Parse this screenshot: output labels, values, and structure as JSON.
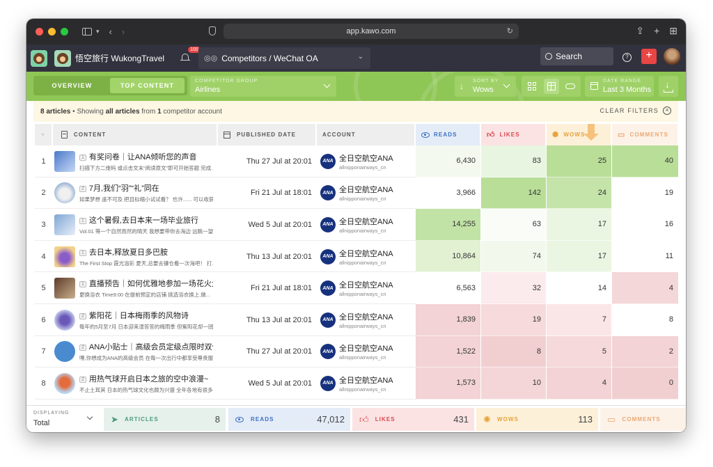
{
  "browser": {
    "url": "app.kawo.com"
  },
  "header": {
    "brand_name": "悟空旅行 WukongTravel",
    "notification_count": "100",
    "competitor_path": "Competitors / WeChat OA",
    "search_label": "Search",
    "help_icon": "?",
    "add_icon": "+"
  },
  "toolbar": {
    "tab_overview": "OVERVIEW",
    "tab_top_content": "TOP CONTENT",
    "competitor_group_label": "COMPETITOR GROUP",
    "competitor_group_value": "Airlines",
    "sort_by_label": "SORT BY",
    "sort_by_value": "Wows",
    "date_range_label": "DATE RANGE",
    "date_range_value": "Last 3 Months"
  },
  "notice": {
    "count": "8 articles",
    "sep": " • ",
    "showing_pre": "Showing ",
    "all_articles": "all articles",
    "from": " from ",
    "one": "1",
    "post": " competitor account",
    "clear_filters": "CLEAR FILTERS"
  },
  "table": {
    "headers": {
      "content": "CONTENT",
      "published": "PUBLISHED DATE",
      "account": "ACCOUNT",
      "reads": "READS",
      "likes": "LIKES",
      "wows": "WOWS",
      "comments": "COMMENTS"
    },
    "rows": [
      {
        "rank": "1",
        "pos": "1",
        "title": "有奖问卷｜让ANA倾听您的声音",
        "sub": "扫描下方二维码 或点击文末“阅读原文”即可开始答题 完成...",
        "date": "Thu 27 Jul at 20:01",
        "account": "全日空航空ANA",
        "handle": "allnipponairways_cn",
        "reads": "6,430",
        "likes": "83",
        "wows": "25",
        "comments": "40"
      },
      {
        "rank": "2",
        "pos": "2",
        "title": "7月,我们“羽”“礼”同在",
        "sub": "如果梦想 遥不可及 把目标缩小试试看？ 也许...... 可以收获...",
        "date": "Fri 21 Jul at 18:01",
        "account": "全日空航空ANA",
        "handle": "allnipponairways_cn",
        "reads": "3,966",
        "likes": "142",
        "wows": "24",
        "comments": "19"
      },
      {
        "rank": "3",
        "pos": "1",
        "title": "这个暑假,去日本来一场毕业旅行",
        "sub": "Vol.01 等一个自然而然的晴天 我想要带你去海边 远眺一望...",
        "date": "Wed 5 Jul at 20:01",
        "account": "全日空航空ANA",
        "handle": "allnipponairways_cn",
        "reads": "14,255",
        "likes": "63",
        "wows": "17",
        "comments": "16"
      },
      {
        "rank": "4",
        "pos": "1",
        "title": "去日本,释放夏日多巴胺",
        "sub": "The First Stop 霞光溢彩 夏天,总要去镰仓看一次海吧！ 打...",
        "date": "Thu 13 Jul at 20:01",
        "account": "全日空航空ANA",
        "handle": "allnipponairways_cn",
        "reads": "10,864",
        "likes": "74",
        "wows": "17",
        "comments": "11"
      },
      {
        "rank": "5",
        "pos": "1",
        "title": "直播预告｜如何优雅地参加一场花火大...",
        "sub": "更换浴衣 Time9:00 在提前预定的店铺 挑选浴衣换上,做...",
        "date": "Fri 21 Jul at 18:01",
        "account": "全日空航空ANA",
        "handle": "allnipponairways_cn",
        "reads": "6,563",
        "likes": "32",
        "wows": "14",
        "comments": "4"
      },
      {
        "rank": "6",
        "pos": "2",
        "title": "紫阳花｜日本梅雨季的风物诗",
        "sub": "每年的5月至7月 日本迎来湿答答的梅雨季 但紫阳花却一团...",
        "date": "Thu 13 Jul at 20:01",
        "account": "全日空航空ANA",
        "handle": "allnipponairways_cn",
        "reads": "1,839",
        "likes": "19",
        "wows": "7",
        "comments": "8"
      },
      {
        "rank": "7",
        "pos": "2",
        "title": "ANA小贴士｜高级会员定级点限时双倍...",
        "sub": "嘿,你想成为ANA的高级会员 在每一次出行中都享受尊贵服...",
        "date": "Thu 27 Jul at 20:01",
        "account": "全日空航空ANA",
        "handle": "allnipponairways_cn",
        "reads": "1,522",
        "likes": "8",
        "wows": "5",
        "comments": "2"
      },
      {
        "rank": "8",
        "pos": "2",
        "title": "用热气球开启日本之旅的空中浪漫~",
        "sub": "不止土耳其 日本的热气球文化也颇为兴盛 全年各地有很多...",
        "date": "Wed 5 Jul at 20:01",
        "account": "全日空航空ANA",
        "handle": "allnipponairways_cn",
        "reads": "1,573",
        "likes": "10",
        "wows": "4",
        "comments": "0"
      }
    ],
    "ana_logo_text": "ANA"
  },
  "cell_colors": {
    "reads": [
      "#f4f9f0",
      "#ffffff",
      "#c2e3a6",
      "#e1f1d2",
      "#ffffff",
      "#f3d3d5",
      "#f3d3d5",
      "#f3d3d5"
    ],
    "likes": [
      "#e8f5e0",
      "#b9de98",
      "#fafcf8",
      "#f2f9ec",
      "#fcebec",
      "#f6dadc",
      "#f1cfd1",
      "#f4d6d8"
    ],
    "wows": [
      "#b9de98",
      "#c4e4a9",
      "#ebf6e2",
      "#ebf6e2",
      "#ffffff",
      "#fbe6e7",
      "#f5d9db",
      "#f3d3d5"
    ],
    "comments": [
      "#b9de98",
      "#ffffff",
      "#ffffff",
      "#ffffff",
      "#f4d7d9",
      "#ffffff",
      "#f3d3d5",
      "#f1cfd1"
    ]
  },
  "thumbs": [
    "linear-gradient(135deg,#4a79c9,#c7d8f5)",
    "radial-gradient(circle at 50% 55%, #f0f0f0 35%, #9fb8d8 70%)",
    "linear-gradient(135deg,#7fa6d6,#e7eef7)",
    "radial-gradient(circle at 50% 55%, #8a5cc9 30%, #f3d08a 70%)",
    "linear-gradient(135deg,#5d3a2a,#c9b08c)",
    "radial-gradient(circle at 50% 50%, #6a58b8 30%, #cfd8f0 75%)",
    "#4a8bd0",
    "radial-gradient(circle at 50% 45%, #e36b3c 30%, #b9d3ef 65%)"
  ],
  "footer": {
    "displaying_label": "DISPLAYING",
    "displaying_value": "Total",
    "articles_label": "ARTICLES",
    "articles_value": "8",
    "reads_label": "READS",
    "reads_value": "47,012",
    "likes_label": "LIKES",
    "likes_value": "431",
    "wows_label": "WOWS",
    "wows_value": "113",
    "comments_label": "COMMENTS"
  }
}
